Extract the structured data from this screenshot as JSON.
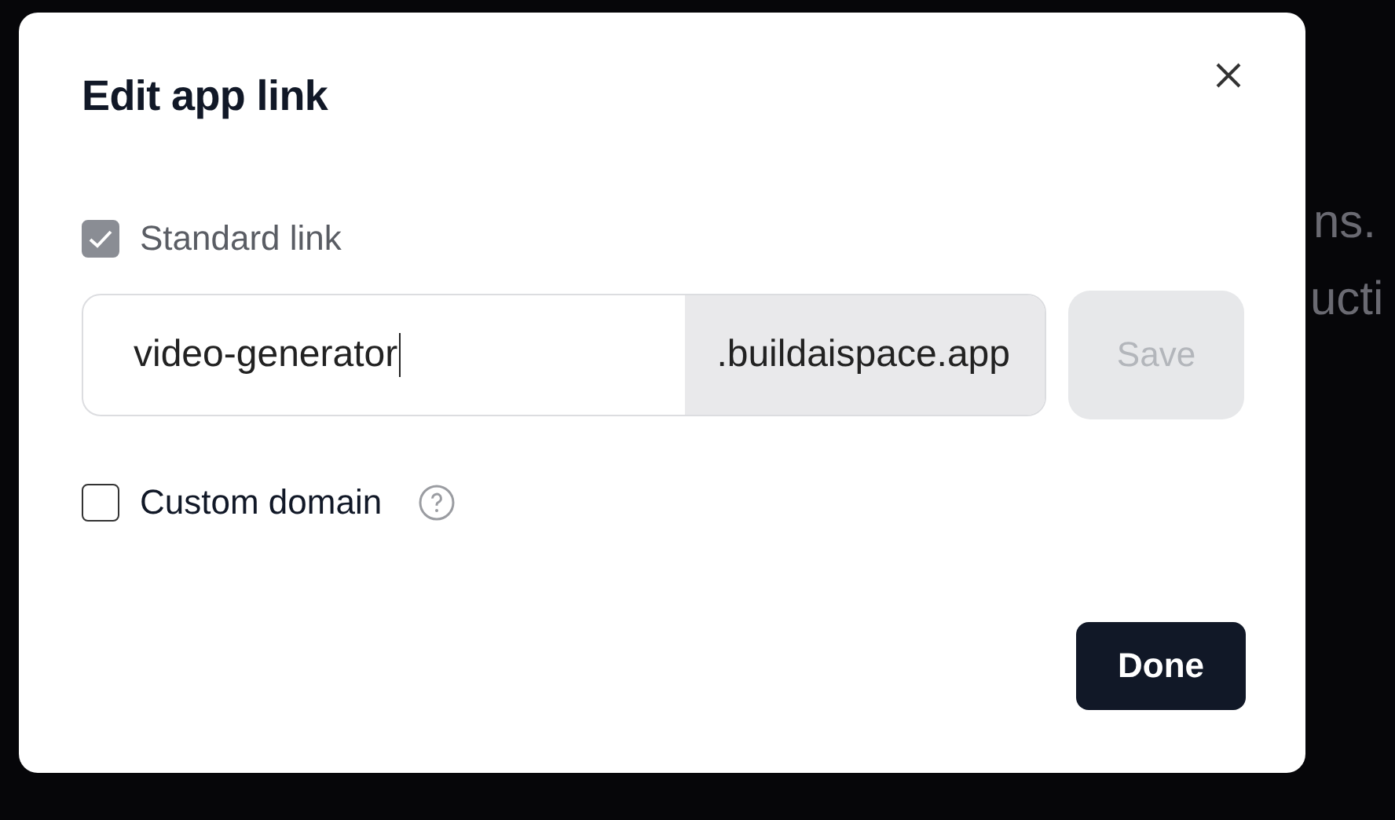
{
  "background": {
    "fragments": [
      {
        "kind": "line",
        "text": "ns."
      },
      {
        "kind": "line",
        "text": "ucti"
      }
    ]
  },
  "dialog": {
    "title": "Edit app link",
    "standard_link": {
      "label": "Standard link",
      "checked": true,
      "disabled": true
    },
    "subdomain": {
      "value": "video-generator",
      "suffix": ".buildaispace.app"
    },
    "save_button": {
      "label": "Save",
      "disabled": true
    },
    "custom_domain": {
      "label": "Custom domain",
      "checked": false,
      "disabled": false
    },
    "done_button": {
      "label": "Done"
    }
  }
}
